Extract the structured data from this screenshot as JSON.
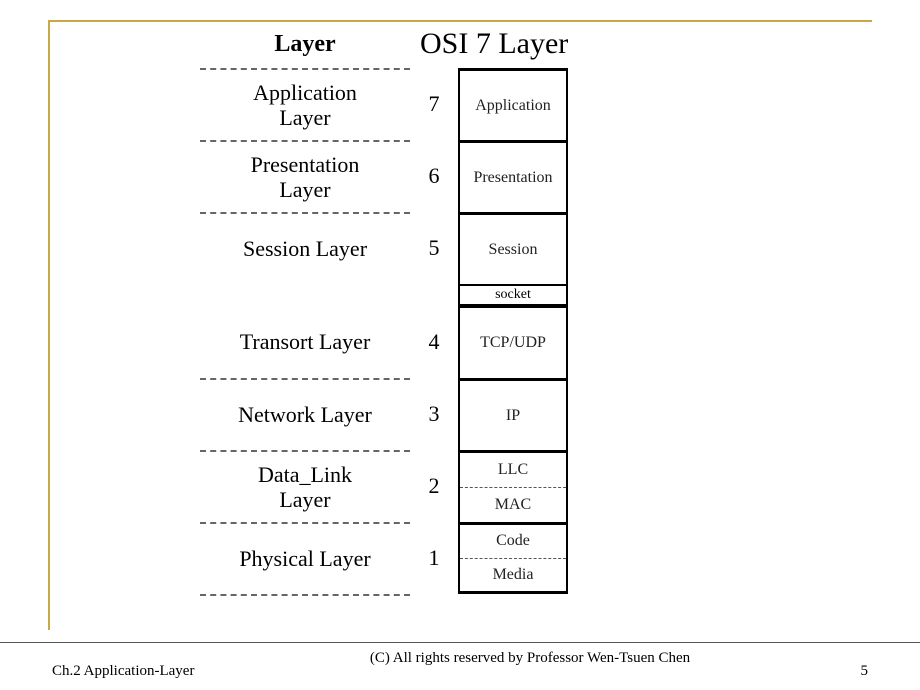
{
  "header": {
    "left": "Layer",
    "right": "OSI 7 Layer"
  },
  "rows": [
    {
      "name": "Application\nLayer",
      "num": "7",
      "box": [
        "Application"
      ]
    },
    {
      "name": "Presentation\nLayer",
      "num": "6",
      "box": [
        "Presentation"
      ]
    },
    {
      "name": "Session Layer",
      "num": "5",
      "box": [
        "Session"
      ]
    },
    {
      "socket": "socket"
    },
    {
      "name": "Transort Layer",
      "num": "4",
      "box": [
        "TCP/UDP"
      ]
    },
    {
      "name": "Network Layer",
      "num": "3",
      "box": [
        "IP"
      ]
    },
    {
      "name": "Data_Link\nLayer",
      "num": "2",
      "box": [
        "LLC",
        "MAC"
      ]
    },
    {
      "name": "Physical Layer",
      "num": "1",
      "box": [
        "Code",
        "Media"
      ]
    }
  ],
  "footer": {
    "left": "Ch.2 Application-Layer",
    "center": "(C) All rights reserved by Professor Wen-Tsuen Chen",
    "page": "5"
  }
}
